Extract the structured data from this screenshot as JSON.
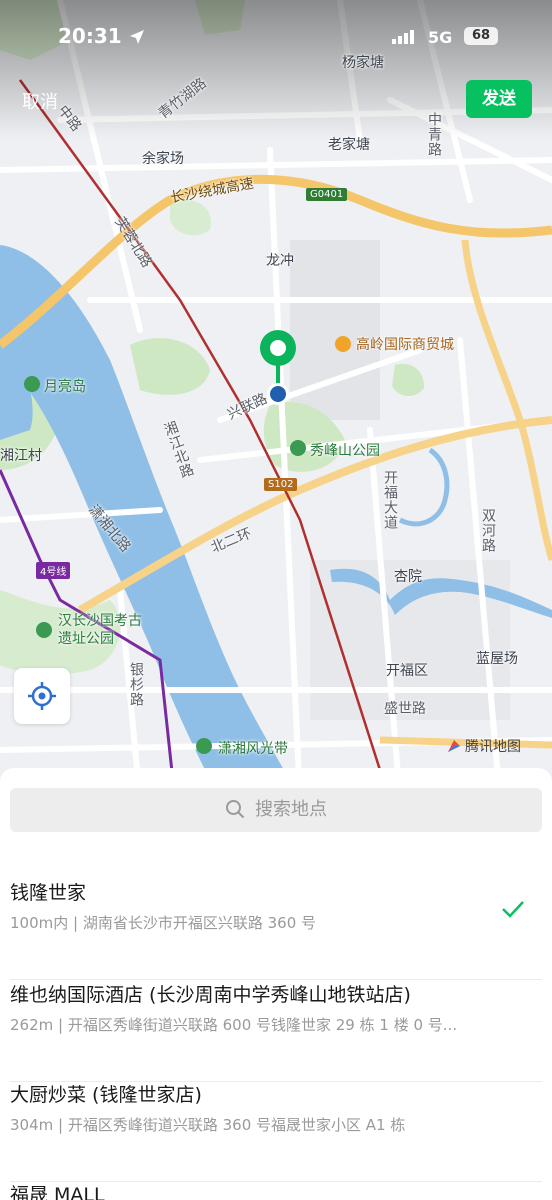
{
  "status_bar": {
    "time": "20:31",
    "network": "5G",
    "battery": "68"
  },
  "header": {
    "cancel_label": "取消",
    "send_label": "发送"
  },
  "map": {
    "labels": {
      "yangjiatang": "杨家塘",
      "laojiatang": "老家塘",
      "zhongqinglu": "中青路",
      "qingzhuhulu": "青竹湖路",
      "yujiachang": "余家场",
      "changsha_ring": "长沙绕城高速",
      "g0401": "G0401",
      "furongbeilu": "芙蓉北路",
      "longchong": "龙冲",
      "gaoling": "高岭国际商贸城",
      "yueliangdao": "月亮岛",
      "xinglianlu": "兴联路",
      "xiufengshan": "秀峰山公园",
      "xiangjiangcun": "湘江村",
      "xiangjiangbeilu": "湘江北路",
      "s102": "S102",
      "kaifudadao": "开福大道",
      "shuangheLu": "双河路",
      "xiaoxiangbeilu": "潇湘北路",
      "beierhuan": "北二环",
      "line4": "4号线",
      "xingyuan": "杏院",
      "hanchangsha": "汉长沙国考古遗址公园",
      "kaifuqu": "开福区",
      "lanwuchang": "蓝屋场",
      "yinshanlu": "银杉路",
      "shengshilu": "盛世路",
      "xiaoxiangfengguang": "潇湘风光带",
      "zhonglu": "中路",
      "tencent_map": "腾讯地图"
    }
  },
  "search": {
    "placeholder": "搜索地点"
  },
  "results": [
    {
      "title": "钱隆世家",
      "subtitle": "100m内 | 湖南省长沙市开福区兴联路 360 号",
      "selected": true
    },
    {
      "title": "维也纳国际酒店 (长沙周南中学秀峰山地铁站店)",
      "subtitle": "262m | 开福区秀峰街道兴联路 600 号钱隆世家 29 栋 1 楼 0 号...",
      "selected": false
    },
    {
      "title": "大厨炒菜 (钱隆世家店)",
      "subtitle": "304m | 开福区秀峰街道兴联路 360 号福晟世家小区 A1 栋",
      "selected": false
    },
    {
      "title": "福晟 MALL",
      "subtitle": "",
      "selected": false
    }
  ],
  "colors": {
    "accent": "#07c160",
    "pin": "#0bb35a",
    "pin_dot": "#1f5fae",
    "river": "#8fbfe6",
    "park": "#cfe8c4",
    "highway": "#f5c56a"
  }
}
